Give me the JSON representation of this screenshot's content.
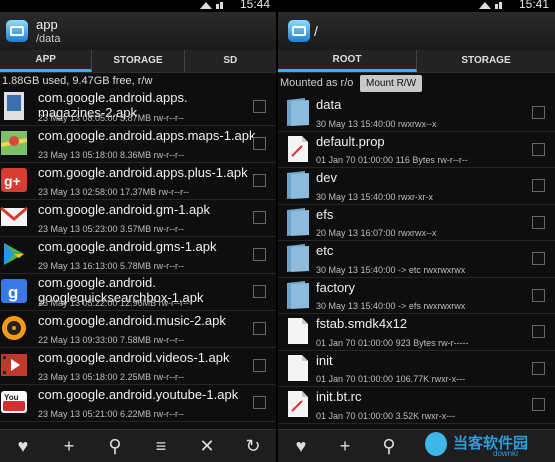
{
  "left": {
    "time": "15:44",
    "title": "app",
    "path": "/data",
    "tabs": [
      "APP",
      "STORAGE",
      "SD"
    ],
    "info": "1.88GB used, 9.47GB free, r/w",
    "files": [
      {
        "name_line1": "com.google.android.apps.",
        "name_line2": "magazines-2.apk",
        "meta": "23 May 13 08:05:00  5.87MB  rw-r--r--",
        "icon": "magazines-icon"
      },
      {
        "name_line1": "com.google.android.apps.maps-1.apk",
        "meta": "23 May 13 05:18:00  8.36MB  rw-r--r--",
        "icon": "maps-icon"
      },
      {
        "name_line1": "com.google.android.apps.plus-1.apk",
        "meta": "23 May 13 02:58:00  17.37MB  rw-r--r--",
        "icon": "google-plus-icon"
      },
      {
        "name_line1": "com.google.android.gm-1.apk",
        "meta": "23 May 13 05:23:00  3.57MB  rw-r--r--",
        "icon": "gmail-icon"
      },
      {
        "name_line1": "com.google.android.gms-1.apk",
        "meta": "29 May 13 16:13:00  5.78MB  rw-r--r--",
        "icon": "play-services-icon"
      },
      {
        "name_line1": "com.google.android.",
        "name_line2": "googlequicksearchbox-1.apk",
        "meta": "23 May 13 05:22:00  12.96MB  rw-r--r--",
        "icon": "google-search-icon"
      },
      {
        "name_line1": "com.google.android.music-2.apk",
        "meta": "22 May 13 09:33:00  7.58MB  rw-r--r--",
        "icon": "music-icon"
      },
      {
        "name_line1": "com.google.android.videos-1.apk",
        "meta": "23 May 13 05:18:00  2.25MB  rw-r--r--",
        "icon": "videos-icon"
      },
      {
        "name_line1": "com.google.android.youtube-1.apk",
        "meta": "23 May 13 05:21:00  6.22MB  rw-r--r--",
        "icon": "youtube-icon"
      }
    ]
  },
  "right": {
    "time": "15:41",
    "title": "/",
    "tabs": [
      "ROOT",
      "STORAGE"
    ],
    "mount_label": "Mounted as r/o",
    "mount_button": "Mount R/W",
    "files": [
      {
        "name": "data",
        "meta": "30 May 13 15:40:00  rwxrwx--x",
        "type": "folder"
      },
      {
        "name": "default.prop",
        "meta": "01 Jan 70 01:00:00  116 Bytes  rw-r--r--",
        "type": "file"
      },
      {
        "name": "dev",
        "meta": "30 May 13 15:40:00  rwxr-xr-x",
        "type": "folder"
      },
      {
        "name": "efs",
        "meta": "20 May 13 16:07:00  rwxrwx--x",
        "type": "folder"
      },
      {
        "name": "etc",
        "meta": "30 May 13 15:40:00  -> etc  rwxrwxrwx",
        "type": "folder"
      },
      {
        "name": "factory",
        "meta": "30 May 13 15:40:00  -> efs  rwxrwxrwx",
        "type": "folder"
      },
      {
        "name": "fstab.smdk4x12",
        "meta": "01 Jan 70 01:00:00  923 Bytes  rw-r-----",
        "type": "file"
      },
      {
        "name": "init",
        "meta": "01 Jan 70 01:00:00  106.77K  rwxr-x---",
        "type": "file"
      },
      {
        "name": "init.bt.rc",
        "meta": "01 Jan 70 01:00:00  3.52K  rwxr-x---",
        "type": "file"
      }
    ]
  },
  "watermark": {
    "text": "当客软件园",
    "sub": "downkr"
  },
  "colors": {
    "accent": "#2fb4ff",
    "background": "#0e0e0e"
  }
}
